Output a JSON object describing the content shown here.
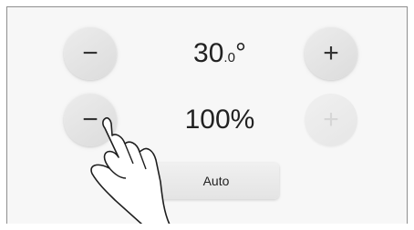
{
  "temperature": {
    "decrease_label": "−",
    "increase_label": "+",
    "value_main": "30",
    "value_decimal": ".0",
    "unit": "°"
  },
  "fan": {
    "decrease_label": "−",
    "increase_label": "+",
    "increase_disabled": true,
    "value": "100%"
  },
  "mode": {
    "auto_label": "Auto"
  },
  "icons": {
    "pointer": "hand-pointer-icon"
  },
  "colors": {
    "panel_background": "#f7f7f7",
    "button_face": "#e4e4e4",
    "text": "#222222",
    "disabled_text": "#d6d6d6"
  }
}
